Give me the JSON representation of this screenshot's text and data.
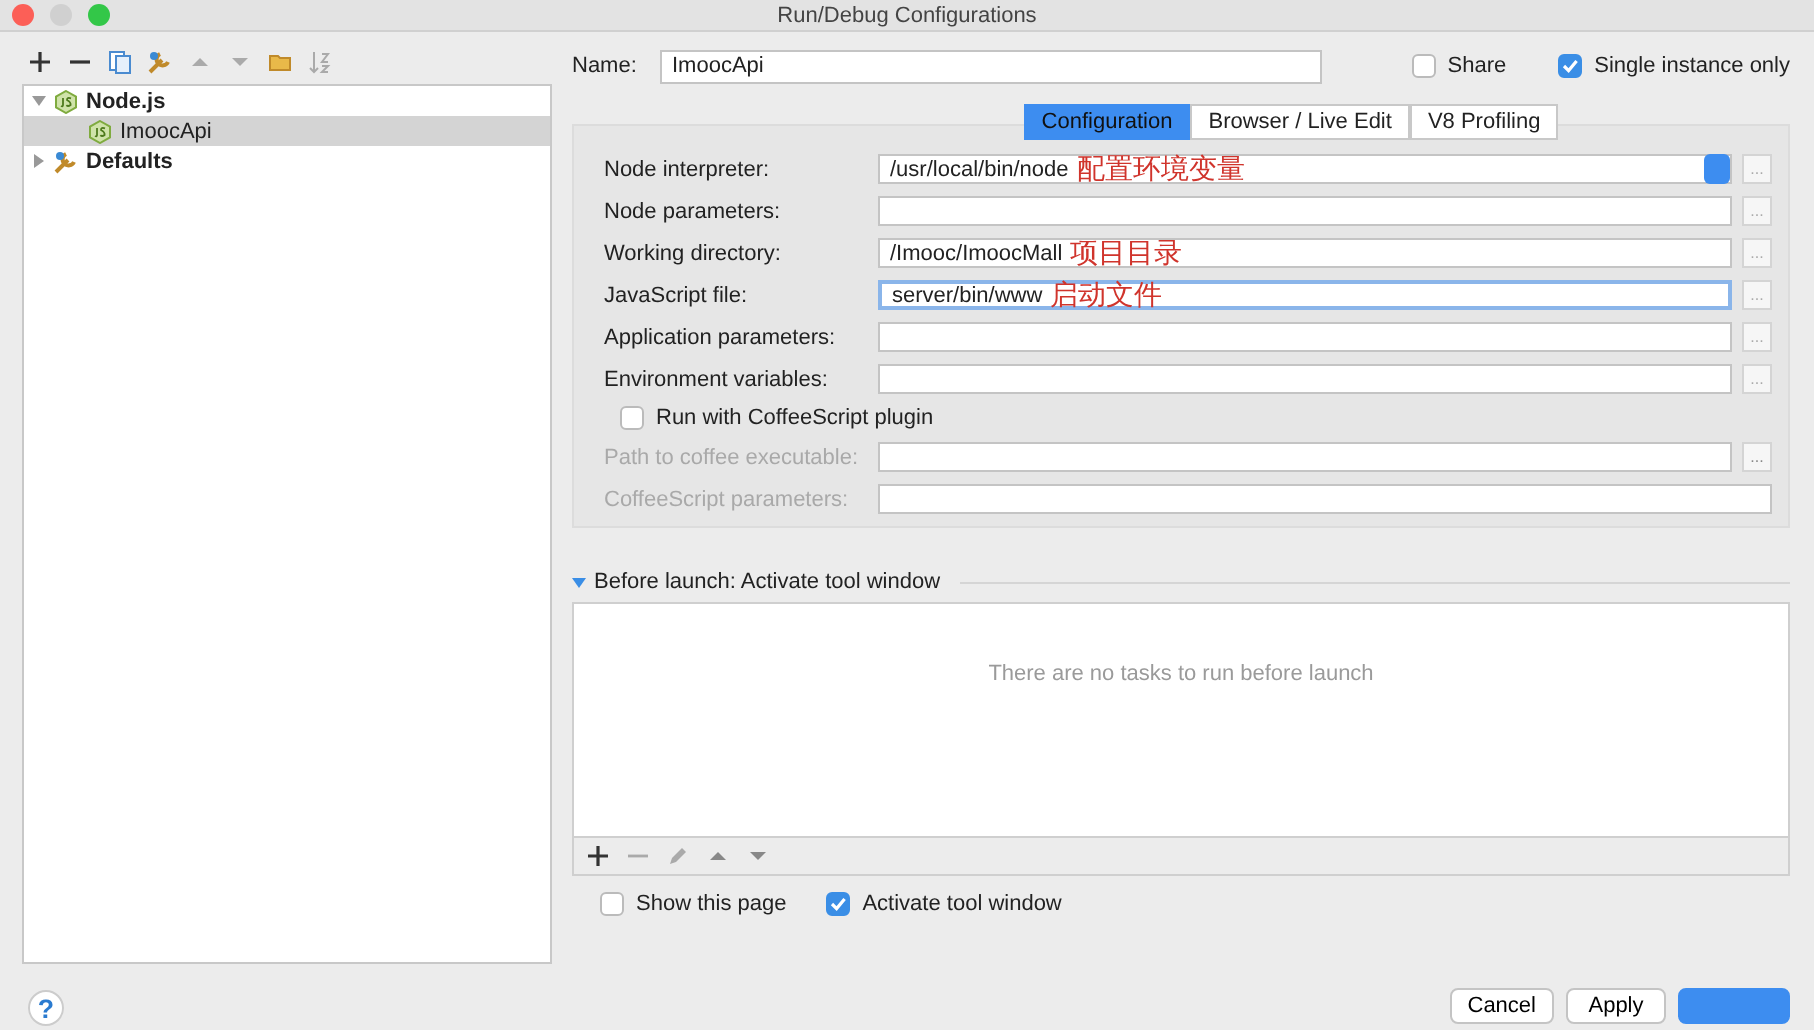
{
  "window": {
    "title": "Run/Debug Configurations"
  },
  "tree": [
    {
      "label": "Node.js",
      "kind": "nodejs",
      "expanded": true,
      "selected": false,
      "children": [
        {
          "label": "ImoocApi",
          "kind": "nodejs",
          "selected": true
        }
      ]
    },
    {
      "label": "Defaults",
      "kind": "defaults",
      "expanded": false,
      "selected": false
    }
  ],
  "name": {
    "label": "Name:",
    "value": "ImoocApi"
  },
  "share": {
    "label": "Share",
    "checked": false
  },
  "single_instance": {
    "label": "Single instance only",
    "checked": true
  },
  "tabs": [
    {
      "label": "Configuration",
      "selected": true
    },
    {
      "label": "Browser / Live Edit",
      "selected": false
    },
    {
      "label": "V8 Profiling",
      "selected": false
    }
  ],
  "fields": [
    {
      "kind": "select",
      "label": "Node interpreter:",
      "value": "/usr/local/bin/node",
      "annotation": "配置环境变量",
      "browse": "...",
      "disabled": false,
      "focused": false
    },
    {
      "kind": "text",
      "label": "Node parameters:",
      "browse": "...",
      "disabled": false,
      "focused": false
    },
    {
      "kind": "text",
      "label": "Working directory:",
      "value": "/Imooc/ImoocMall",
      "annotation": "项目目录",
      "browse": "...",
      "disabled": false,
      "focused": false
    },
    {
      "kind": "text",
      "label": "JavaScript file:",
      "value": "server/bin/www",
      "annotation": "启动文件",
      "browse": "...",
      "disabled": false,
      "focused": true
    },
    {
      "kind": "text",
      "label": "Application parameters:",
      "browse": "...",
      "disabled": false,
      "focused": false
    },
    {
      "kind": "text",
      "label": "Environment variables:",
      "browse": "...",
      "disabled": false,
      "focused": false
    },
    {
      "kind": "checkbox",
      "label": "Run with CoffeeScript plugin",
      "checked": false
    },
    {
      "kind": "text",
      "label": "Path to coffee executable:",
      "browse": "...",
      "disabled": true,
      "focused": false
    },
    {
      "kind": "text",
      "label": "CoffeeScript parameters:",
      "disabled": true,
      "focused": false
    }
  ],
  "before_launch": {
    "title": "Before launch: Activate tool window",
    "expanded": true,
    "empty_text": "There are no tasks to run before launch"
  },
  "options": [
    {
      "label": "Show this page",
      "checked": false
    },
    {
      "label": "Activate tool window",
      "checked": true
    }
  ],
  "buttons": [
    {
      "label": "Cancel",
      "kind": "normal"
    },
    {
      "label": "Apply",
      "kind": "normal"
    },
    {
      "kind": "default"
    }
  ],
  "help": {
    "label": "?"
  }
}
